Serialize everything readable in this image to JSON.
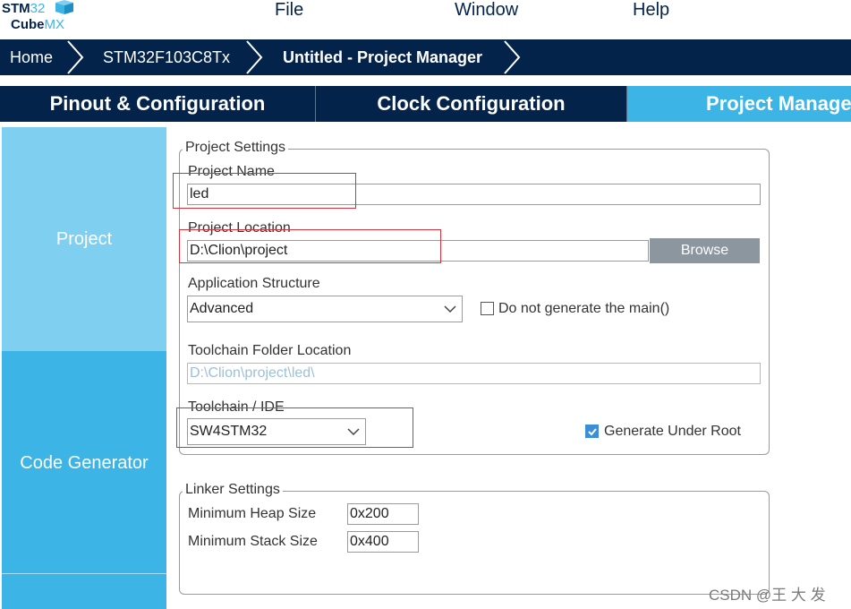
{
  "logo": {
    "line1_a": "STM",
    "line1_b": "32",
    "line2_a": "Cube",
    "line2_b": "MX"
  },
  "menu": {
    "file": "File",
    "window": "Window",
    "help": "Help"
  },
  "breadcrumb": {
    "home": "Home",
    "device": "STM32F103C8Tx",
    "project": "Untitled - Project Manager"
  },
  "tabs": {
    "pinout": "Pinout & Configuration",
    "clock": "Clock Configuration",
    "project_manager": "Project Manager"
  },
  "sidebar": {
    "project": "Project",
    "code_generator": "Code Generator"
  },
  "project_settings": {
    "legend": "Project Settings",
    "name_label": "Project Name",
    "name_value": "led",
    "location_label": "Project Location",
    "location_value": "D:\\Clion\\project",
    "browse_label": "Browse",
    "app_structure_label": "Application Structure",
    "app_structure_value": "Advanced",
    "no_main_label": "Do not generate the main()",
    "toolchain_folder_label": "Toolchain Folder Location",
    "toolchain_folder_value": "D:\\Clion\\project\\led\\",
    "toolchain_ide_label": "Toolchain / IDE",
    "toolchain_ide_value": "SW4STM32",
    "generate_under_root_label": "Generate Under Root"
  },
  "linker_settings": {
    "legend": "Linker Settings",
    "heap_label": "Minimum Heap Size",
    "heap_value": "0x200",
    "stack_label": "Minimum Stack Size",
    "stack_value": "0x400"
  },
  "checkboxes": {
    "no_main_checked": false,
    "generate_under_root_checked": true
  },
  "colors": {
    "navy": "#03234b",
    "accent": "#3cb4e6",
    "highlight_box": "#d4333d"
  },
  "watermark": "CSDN @王 大 发"
}
